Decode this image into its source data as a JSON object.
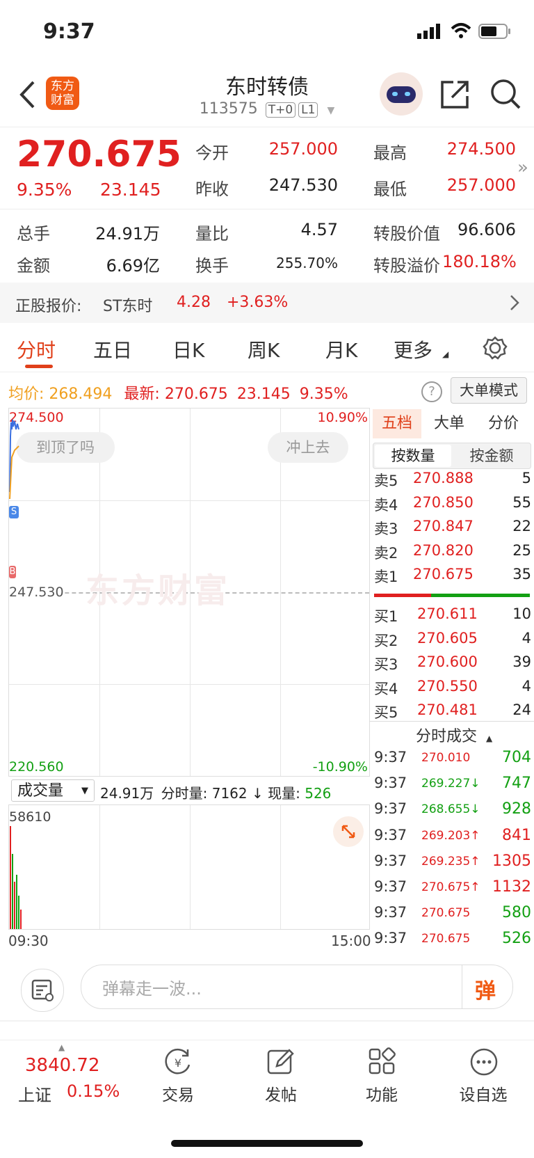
{
  "status_bar": {
    "time": "9:37"
  },
  "header": {
    "back_icon": "chevron-left-icon",
    "logo_text": "东方财富",
    "title": "东时转债",
    "code": "113575",
    "tag1": "T+0",
    "tag2": "L1"
  },
  "quote": {
    "price": "270.675",
    "change_pct": "9.35%",
    "change": "23.145",
    "open_label": "今开",
    "open": "257.000",
    "high_label": "最高",
    "high": "274.500",
    "prev_close_label": "昨收",
    "prev_close": "247.530",
    "low_label": "最低",
    "low": "257.000",
    "volume_label": "总手",
    "volume": "24.91万",
    "vol_ratio_label": "量比",
    "vol_ratio": "4.57",
    "conv_value_label": "转股价值",
    "conv_value": "96.606",
    "amount_label": "金额",
    "amount": "6.69亿",
    "turnover_label": "换手",
    "turnover": "255.70%",
    "premium_label": "转股溢价",
    "premium": "180.18%"
  },
  "underlying": {
    "label": "正股报价:",
    "name": "ST东时",
    "price": "4.28",
    "change": "+3.63%"
  },
  "tabs": [
    "分时",
    "五日",
    "日K",
    "周K",
    "月K",
    "更多"
  ],
  "info_bar": {
    "avg_label": "均价:",
    "avg": "268.494",
    "latest_label": "最新:",
    "latest": "270.675",
    "change": "23.145",
    "pct": "9.35%",
    "mode_button": "大单模式"
  },
  "chart": {
    "top_price": "274.500",
    "top_pct": "10.90%",
    "mid_price": "247.530",
    "bottom_price": "220.560",
    "bottom_pct": "-10.90%",
    "bubble_left": "到顶了吗",
    "bubble_right": "冲上去",
    "watermark": "东方财富",
    "marker_s": "S",
    "marker_b": "B"
  },
  "volume_bar": {
    "selector": "成交量",
    "total": "24.91万",
    "minute_label": "分时量:",
    "minute": "7162",
    "current_label": "现量:",
    "current": "526",
    "max": "58610",
    "start_time": "09:30",
    "end_time": "15:00"
  },
  "orderbook": {
    "tabs": [
      "五档",
      "大单",
      "分价"
    ],
    "subtabs": [
      "按数量",
      "按金额"
    ],
    "asks": [
      {
        "name": "卖5",
        "price": "270.888",
        "qty": "5"
      },
      {
        "name": "卖4",
        "price": "270.850",
        "qty": "55"
      },
      {
        "name": "卖3",
        "price": "270.847",
        "qty": "22"
      },
      {
        "name": "卖2",
        "price": "270.820",
        "qty": "25"
      },
      {
        "name": "卖1",
        "price": "270.675",
        "qty": "35"
      }
    ],
    "bids": [
      {
        "name": "买1",
        "price": "270.611",
        "qty": "10"
      },
      {
        "name": "买2",
        "price": "270.605",
        "qty": "4"
      },
      {
        "name": "买3",
        "price": "270.600",
        "qty": "39"
      },
      {
        "name": "买4",
        "price": "270.550",
        "qty": "4"
      },
      {
        "name": "买5",
        "price": "270.481",
        "qty": "24"
      }
    ],
    "trades_title": "分时成交",
    "trades": [
      {
        "time": "9:37",
        "price": "270.010",
        "qty": "704",
        "dir": "",
        "color": "#13a013"
      },
      {
        "time": "9:37",
        "price": "269.227↓",
        "qty": "747",
        "dir": "down",
        "color": "#13a013"
      },
      {
        "time": "9:37",
        "price": "268.655↓",
        "qty": "928",
        "dir": "down",
        "color": "#13a013"
      },
      {
        "time": "9:37",
        "price": "269.203↑",
        "qty": "841",
        "dir": "up",
        "color": "#e02020"
      },
      {
        "time": "9:37",
        "price": "269.235↑",
        "qty": "1305",
        "dir": "up",
        "color": "#e02020"
      },
      {
        "time": "9:37",
        "price": "270.675↑",
        "qty": "1132",
        "dir": "up",
        "color": "#e02020"
      },
      {
        "time": "9:37",
        "price": "270.675",
        "qty": "580",
        "dir": "",
        "color": "#13a013"
      },
      {
        "time": "9:37",
        "price": "270.675",
        "qty": "526",
        "dir": "",
        "color": "#13a013"
      }
    ]
  },
  "danmu": {
    "placeholder": "弹幕走一波...",
    "button": "弹"
  },
  "bottom_bar": {
    "index_value": "3840.72",
    "index_name": "上证",
    "index_pct": "0.15%",
    "items": [
      "交易",
      "发帖",
      "功能",
      "设自选"
    ]
  },
  "colors": {
    "up": "#e02020",
    "down": "#13a013",
    "accent": "#f05a14",
    "avg_line": "#f0a020"
  }
}
